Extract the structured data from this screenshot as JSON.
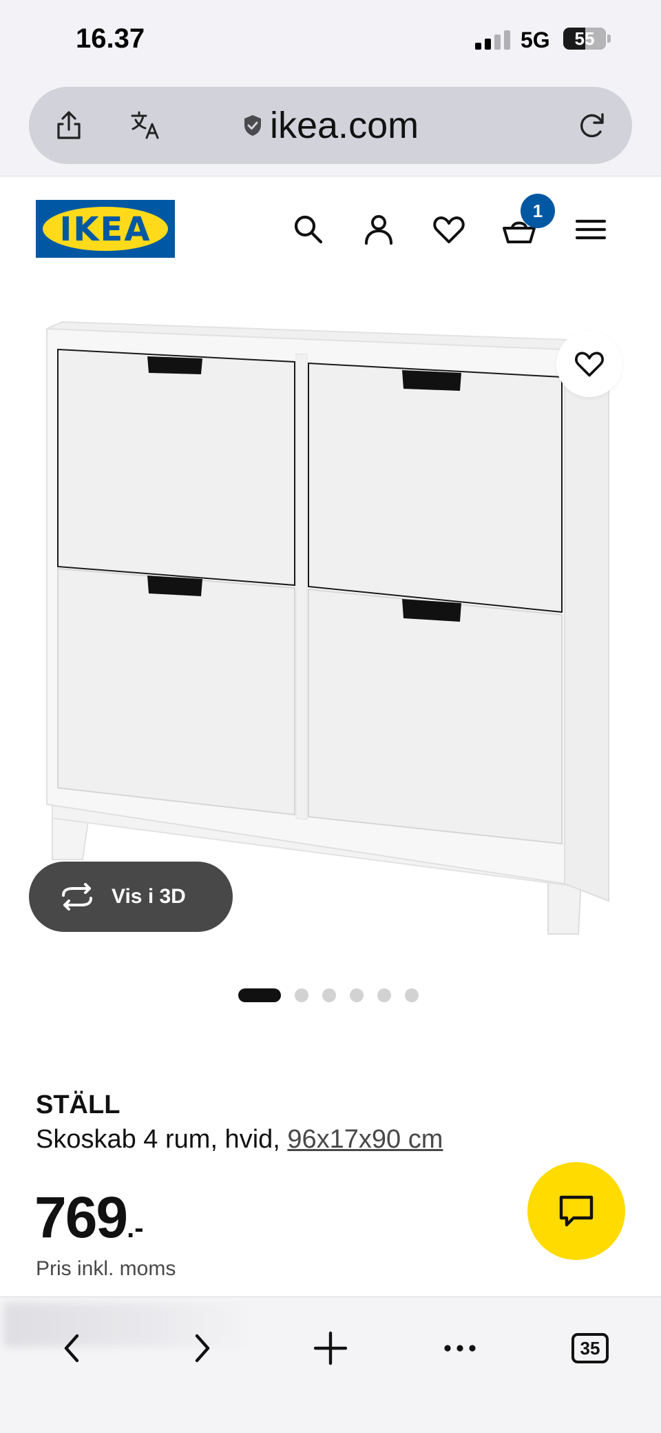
{
  "status_bar": {
    "time": "16.37",
    "network": "5G",
    "battery": "55",
    "signal_bars_active": 2,
    "signal_bars_total": 4
  },
  "browser": {
    "url": "ikea.com",
    "icons": [
      "share-icon",
      "translate-icon",
      "shield-icon",
      "reload-icon"
    ]
  },
  "site_header": {
    "logo_text": "IKEA",
    "brand_colors": {
      "blue": "#0058a3",
      "yellow": "#ffda1a"
    },
    "icons": [
      "search-icon",
      "user-icon",
      "heart-icon",
      "basket-icon",
      "menu-icon"
    ],
    "cart_count": "1"
  },
  "product_image": {
    "view_3d_label": "Vis i 3D",
    "carousel_total": 6,
    "carousel_active": 1
  },
  "product": {
    "name": "STÄLL",
    "description": "Skoskab 4 rum, hvid,",
    "dimensions": "96x17x90 cm",
    "price": "769",
    "price_suffix": ".-",
    "price_note": "Pris inkl. moms"
  },
  "chat": {
    "accent": "#ffdb00"
  },
  "bottom_toolbar": {
    "tab_count": "35",
    "icons": [
      "back-icon",
      "forward-icon",
      "new-tab-icon",
      "more-icon",
      "tabs-icon"
    ]
  }
}
